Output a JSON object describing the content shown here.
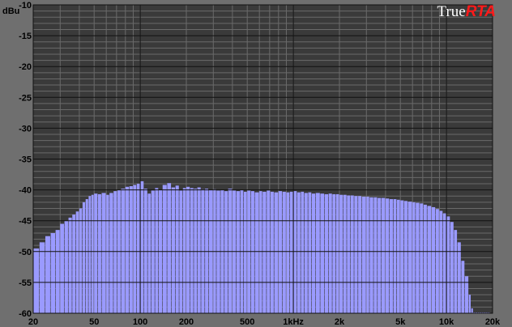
{
  "chart_data": {
    "type": "bar",
    "brand": {
      "text_1": "True",
      "text_2": "RTA"
    },
    "ylabel": "dBu",
    "ylim": [
      -60,
      -10
    ],
    "y_ticks": [
      -10,
      -15,
      -20,
      -25,
      -30,
      -35,
      -40,
      -45,
      -50,
      -55,
      -60
    ],
    "x_scale": "log",
    "xlim": [
      20,
      20000
    ],
    "x_ticks": [
      {
        "value": 20,
        "label": "20"
      },
      {
        "value": 50,
        "label": "50"
      },
      {
        "value": 100,
        "label": "100"
      },
      {
        "value": 200,
        "label": "200"
      },
      {
        "value": 500,
        "label": "500"
      },
      {
        "value": 1000,
        "label": "1kHz"
      },
      {
        "value": 2000,
        "label": "2k"
      },
      {
        "value": 5000,
        "label": "5k"
      },
      {
        "value": 10000,
        "label": "10k"
      },
      {
        "value": 20000,
        "label": "20k"
      }
    ],
    "grid": true,
    "colors": {
      "background": "#6f6f6f",
      "plot": "#3a3a3a",
      "grid_minor": "#6a6a6a",
      "grid_major": "#111111",
      "bars": "#9a9aff"
    },
    "x": [
      20,
      22,
      24,
      26,
      28,
      30,
      32,
      34,
      36,
      38,
      40,
      42,
      44,
      46,
      48,
      50,
      53,
      56,
      60,
      63,
      67,
      71,
      75,
      80,
      85,
      90,
      95,
      100,
      106,
      112,
      118,
      125,
      132,
      140,
      150,
      160,
      170,
      180,
      190,
      200,
      212,
      224,
      236,
      250,
      265,
      280,
      300,
      315,
      335,
      355,
      375,
      400,
      425,
      450,
      475,
      500,
      530,
      560,
      600,
      630,
      670,
      710,
      750,
      800,
      850,
      900,
      950,
      1000,
      1060,
      1120,
      1180,
      1250,
      1320,
      1400,
      1500,
      1600,
      1700,
      1800,
      1900,
      2000,
      2120,
      2240,
      2360,
      2500,
      2650,
      2800,
      3000,
      3150,
      3350,
      3550,
      3750,
      4000,
      4250,
      4500,
      4750,
      5000,
      5300,
      5600,
      6000,
      6300,
      6700,
      7100,
      7500,
      8000,
      8500,
      9000,
      9500,
      10000,
      10600,
      11200,
      11800,
      12500,
      13200,
      14000,
      14500,
      15000,
      15500,
      16000,
      16500,
      17000,
      17500,
      18000,
      18500,
      19000
    ],
    "values": [
      -49.5,
      -48.5,
      -47.5,
      -47,
      -46.5,
      -45.5,
      -45,
      -44.5,
      -44,
      -43.5,
      -43,
      -42,
      -41.5,
      -41,
      -40.8,
      -40.6,
      -40.7,
      -40.5,
      -40.8,
      -40.5,
      -40.2,
      -40,
      -39.8,
      -39.5,
      -39.4,
      -39.2,
      -39,
      -38.6,
      -39.8,
      -40.6,
      -40.1,
      -39.7,
      -40,
      -39.2,
      -38.9,
      -39.6,
      -39.3,
      -40.1,
      -39.7,
      -39.5,
      -39.7,
      -39.8,
      -39.6,
      -39.9,
      -39.8,
      -40,
      -39.9,
      -40.1,
      -40,
      -40.2,
      -39.8,
      -40.1,
      -40.2,
      -40,
      -40.3,
      -40.1,
      -40.2,
      -40.4,
      -40.2,
      -40.3,
      -40.1,
      -40.3,
      -40.4,
      -40.2,
      -40.3,
      -40.4,
      -40.3,
      -40.2,
      -40.4,
      -40.3,
      -40.5,
      -40.4,
      -40.6,
      -40.5,
      -40.6,
      -40.7,
      -40.6,
      -40.7,
      -40.7,
      -40.8,
      -40.8,
      -40.9,
      -40.9,
      -41,
      -41,
      -41.1,
      -41.1,
      -41.2,
      -41.2,
      -41.3,
      -41.3,
      -41.4,
      -41.5,
      -41.5,
      -41.6,
      -41.7,
      -41.8,
      -41.9,
      -42,
      -42.1,
      -42.2,
      -42.4,
      -42.6,
      -42.8,
      -43.1,
      -43.4,
      -43.8,
      -44.3,
      -45.2,
      -46.5,
      -48.5,
      -51.5,
      -54,
      -57,
      -59.2,
      -60,
      -60,
      -60,
      -60,
      -60,
      -60,
      -60,
      -60,
      -60
    ]
  }
}
